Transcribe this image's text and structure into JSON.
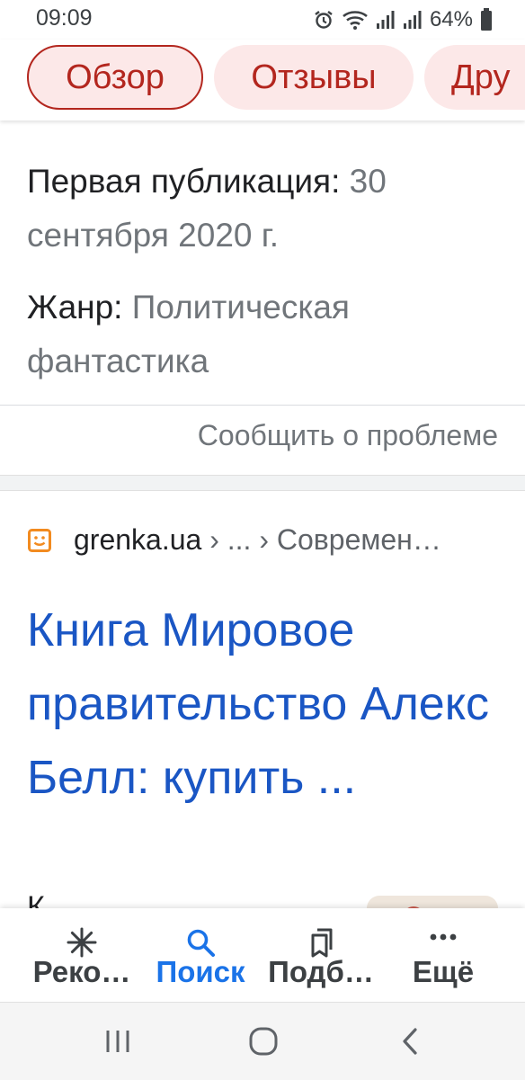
{
  "status_bar": {
    "time": "09:09",
    "battery": "64%",
    "icons": [
      "alarm-icon",
      "wifi-icon",
      "signal-icon",
      "signal-icon",
      "battery-icon"
    ]
  },
  "chips": [
    {
      "label": "Обзор",
      "active": true
    },
    {
      "label": "Отзывы",
      "active": false
    },
    {
      "label": "Дру",
      "active": false
    }
  ],
  "info": {
    "publication_label": "Первая публикация:",
    "publication_value_1": "30",
    "publication_value_2": "сентября 2020 г.",
    "genre_label": "Жанр:",
    "genre_value_1": "Политическая",
    "genre_value_2": "фантастика"
  },
  "report_link": "Сообщить о проблеме",
  "result": {
    "site": "grenka.ua",
    "crumbs": " › ... › Современ…",
    "title": "Книга Мировое правительство Алекс Белл: купить ...",
    "snippet_peek": "К"
  },
  "bottom_nav": [
    {
      "label": "Реко…",
      "icon": "asterisk-icon",
      "active": false
    },
    {
      "label": "Поиск",
      "icon": "search-icon",
      "active": true
    },
    {
      "label": "Подб…",
      "icon": "collections-icon",
      "active": false
    },
    {
      "label": "Ещё",
      "icon": "more-icon",
      "active": false
    }
  ],
  "colors": {
    "chip_accent": "#b3261e",
    "chip_bg": "#fce8e8",
    "link_blue": "#1a56c4",
    "nav_active": "#1a73e8"
  }
}
